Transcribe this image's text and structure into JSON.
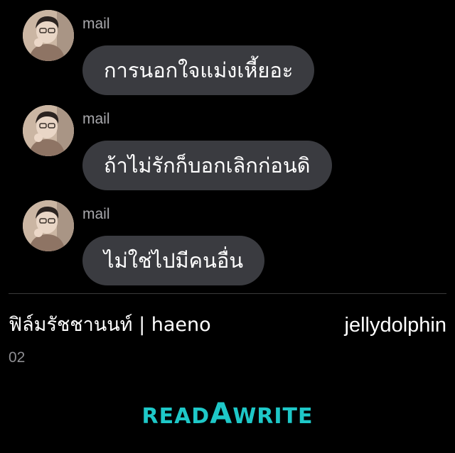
{
  "messages": [
    {
      "sender": "mail",
      "text": "การนอกใจแม่งเหี้ยอะ",
      "avatar": "user-avatar-photo"
    },
    {
      "sender": "mail",
      "text": "ถ้าไม่รักก็บอกเลิกก่อนดิ",
      "avatar": "user-avatar-photo"
    },
    {
      "sender": "mail",
      "text": "ไม่ใช่ไปมีคนอื่น",
      "avatar": "user-avatar-photo"
    }
  ],
  "footer": {
    "title": "ฟิล์มรัชชานนท์ | haeno",
    "author": "jellydolphin",
    "episode": "02"
  },
  "brand": {
    "read": "READ",
    "a": "A",
    "write": "WRITE",
    "color": "#1ec8c8"
  },
  "colors": {
    "background": "#000000",
    "bubble": "#3a3b40",
    "sender": "#a8a8ac"
  }
}
